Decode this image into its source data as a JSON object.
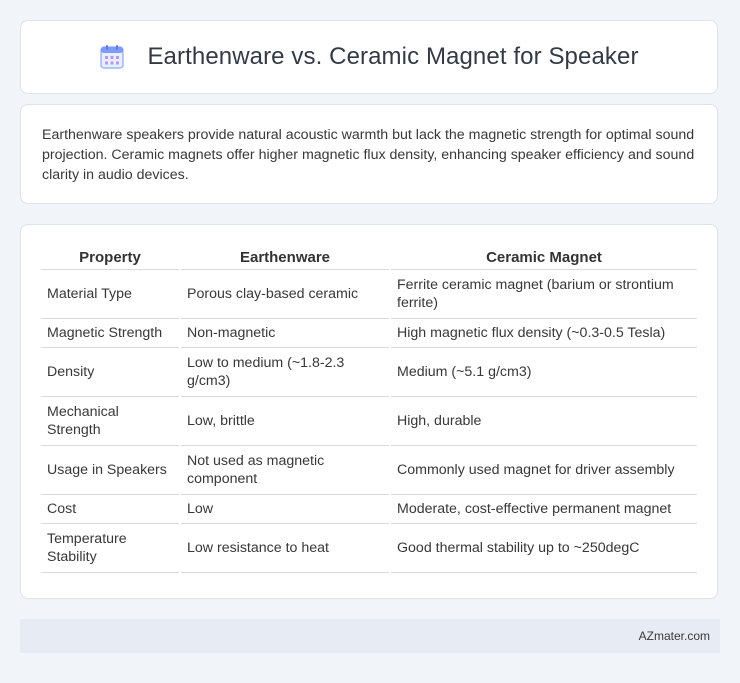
{
  "header": {
    "title": "Earthenware vs. Ceramic Magnet for Speaker",
    "icon": "calendar-icon",
    "icon_color": "#6b8ef5"
  },
  "summary": {
    "text": "Earthenware speakers provide natural acoustic warmth but lack the magnetic strength for optimal sound projection. Ceramic magnets offer higher magnetic flux density, enhancing speaker efficiency and sound clarity in audio devices."
  },
  "table": {
    "headers": [
      "Property",
      "Earthenware",
      "Ceramic Magnet"
    ],
    "rows": [
      [
        "Material Type",
        "Porous clay-based ceramic",
        "Ferrite ceramic magnet (barium or strontium ferrite)"
      ],
      [
        "Magnetic Strength",
        "Non-magnetic",
        "High magnetic flux density (~0.3-0.5 Tesla)"
      ],
      [
        "Density",
        "Low to medium (~1.8-2.3 g/cm3)",
        "Medium (~5.1 g/cm3)"
      ],
      [
        "Mechanical Strength",
        "Low, brittle",
        "High, durable"
      ],
      [
        "Usage in Speakers",
        "Not used as magnetic component",
        "Commonly used magnet for driver assembly"
      ],
      [
        "Cost",
        "Low",
        "Moderate, cost-effective permanent magnet"
      ],
      [
        "Temperature Stability",
        "Low resistance to heat",
        "Good thermal stability up to ~250degC"
      ]
    ]
  },
  "footer": {
    "text": "AZmater.com"
  }
}
